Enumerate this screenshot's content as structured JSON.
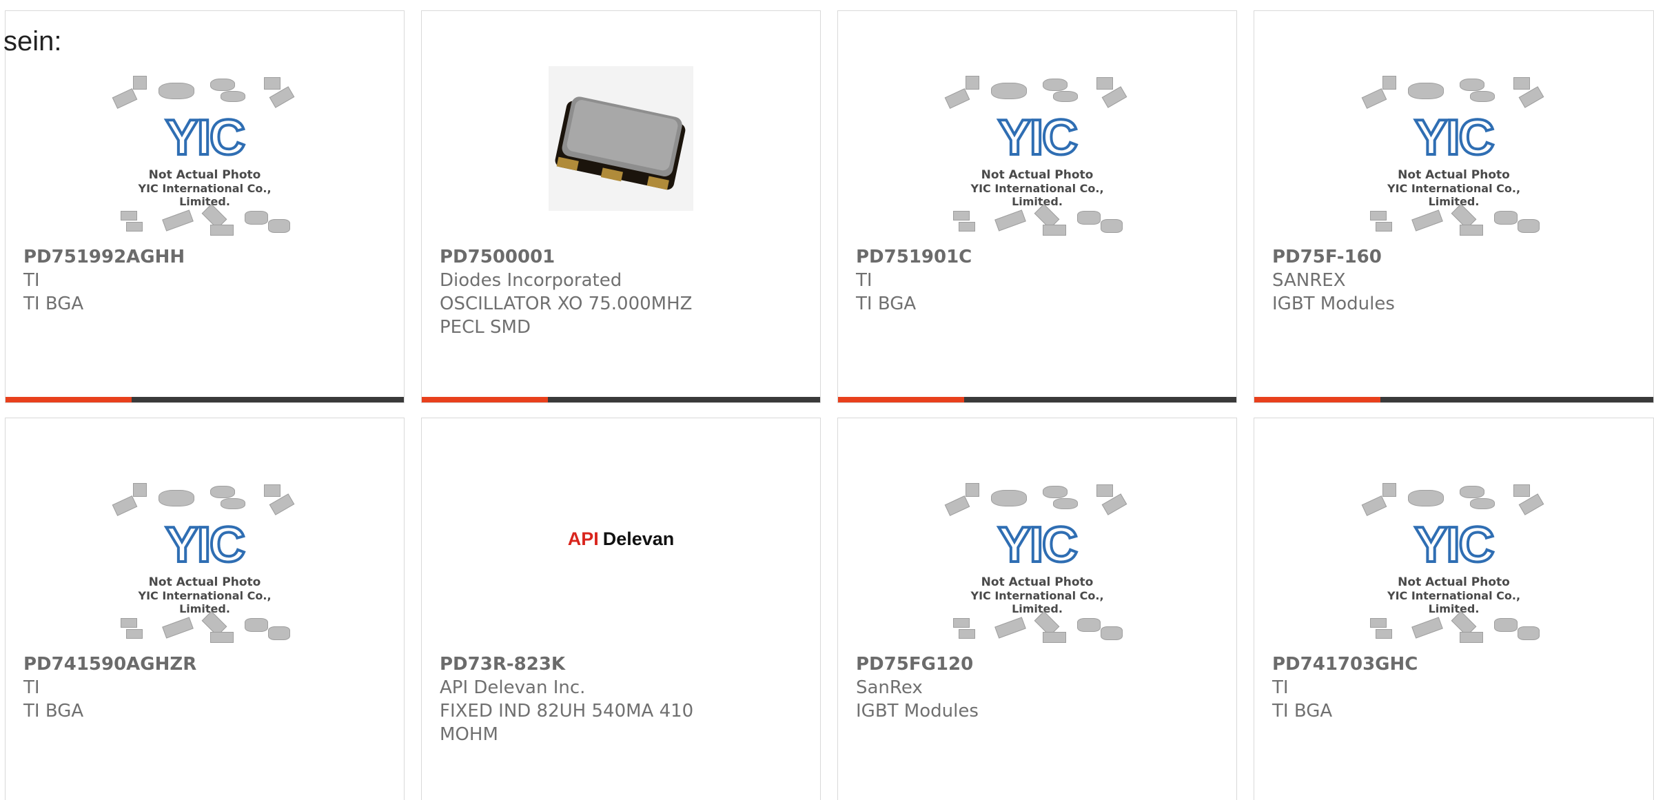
{
  "lead_text": "sein:",
  "placeholder": {
    "logo_text": "YIC",
    "caption_line1": "Not Actual Photo",
    "caption_line2": "YIC International Co., Limited."
  },
  "brand_logo": {
    "part1": "API",
    "part2": "Delevan"
  },
  "colors": {
    "accent": "#e8401c",
    "bar": "#3a3a3a",
    "logo_blue": "#2f6eb3"
  },
  "products": [
    {
      "pn": "PD751992AGHH",
      "mfr": "TI",
      "desc": "TI BGA",
      "image": "placeholder"
    },
    {
      "pn": "PD7500001",
      "mfr": "Diodes Incorporated",
      "desc": "OSCILLATOR XO 75.000MHZ PECL SMD",
      "image": "oscillator-photo"
    },
    {
      "pn": "PD751901C",
      "mfr": "TI",
      "desc": "TI BGA",
      "image": "placeholder"
    },
    {
      "pn": "PD75F-160",
      "mfr": "SANREX",
      "desc": "IGBT Modules",
      "image": "placeholder"
    },
    {
      "pn": "PD741590AGHZR",
      "mfr": "TI",
      "desc": "TI BGA",
      "image": "placeholder"
    },
    {
      "pn": "PD73R-823K",
      "mfr": "API Delevan Inc.",
      "desc": "FIXED IND 82UH 540MA 410 MOHM",
      "image": "brand-logo"
    },
    {
      "pn": "PD75FG120",
      "mfr": "SanRex",
      "desc": "IGBT Modules",
      "image": "placeholder"
    },
    {
      "pn": "PD741703GHC",
      "mfr": "TI",
      "desc": "TI BGA",
      "image": "placeholder"
    }
  ]
}
